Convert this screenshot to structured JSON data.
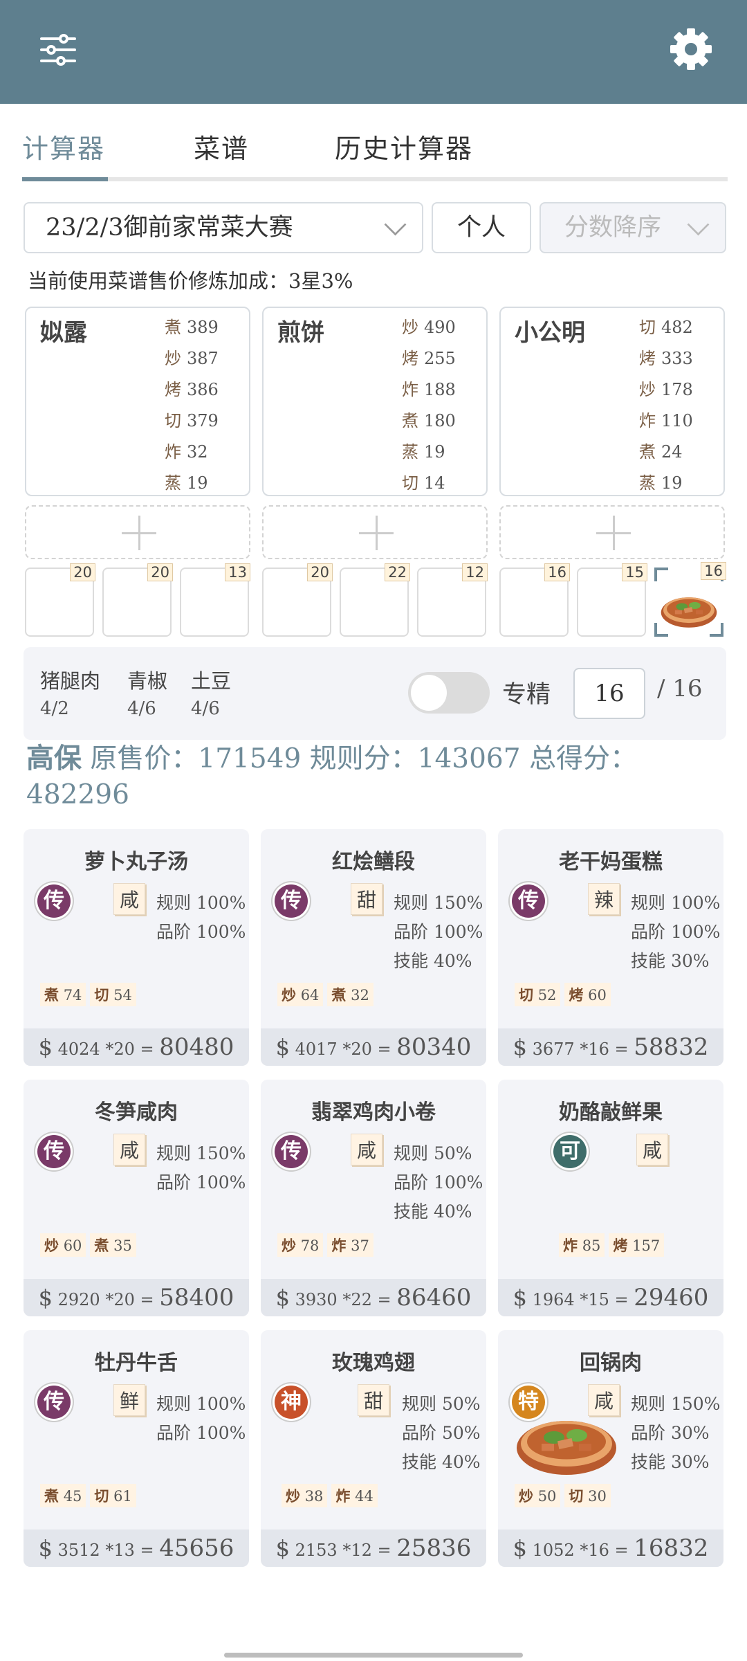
{
  "tabs": [
    "计算器",
    "菜谱",
    "历史计算器"
  ],
  "filters": {
    "contest": "23/2/3御前家常菜大赛",
    "mode": "个人",
    "sort_placeholder": "分数降序"
  },
  "info_line": "当前使用菜谱售价修炼加成：3星3%",
  "chefs": [
    {
      "name": "姒露",
      "skills": [
        {
          "k": "煮",
          "v": "389"
        },
        {
          "k": "炒",
          "v": "387"
        },
        {
          "k": "烤",
          "v": "386"
        },
        {
          "k": "切",
          "v": "379"
        },
        {
          "k": "炸",
          "v": "32"
        },
        {
          "k": "蒸",
          "v": "19"
        }
      ]
    },
    {
      "name": "煎饼",
      "skills": [
        {
          "k": "炒",
          "v": "490"
        },
        {
          "k": "烤",
          "v": "255"
        },
        {
          "k": "炸",
          "v": "188"
        },
        {
          "k": "煮",
          "v": "180"
        },
        {
          "k": "蒸",
          "v": "19"
        },
        {
          "k": "切",
          "v": "14"
        }
      ]
    },
    {
      "name": "小公明",
      "skills": [
        {
          "k": "切",
          "v": "482"
        },
        {
          "k": "烤",
          "v": "333"
        },
        {
          "k": "炒",
          "v": "178"
        },
        {
          "k": "炸",
          "v": "110"
        },
        {
          "k": "煮",
          "v": "24"
        },
        {
          "k": "蒸",
          "v": "19"
        }
      ]
    }
  ],
  "slot_counts": [
    "20",
    "20",
    "13",
    "20",
    "22",
    "12",
    "16",
    "15",
    "16"
  ],
  "ingredients": [
    {
      "name": "猪腿肉",
      "qty": "4/2"
    },
    {
      "name": "青椒",
      "qty": "4/6"
    },
    {
      "name": "土豆",
      "qty": "4/6"
    }
  ],
  "specialize": {
    "label": "专精",
    "value": "16",
    "max": "/ 16"
  },
  "summary": {
    "grade": "高保",
    "text": "原售价：171549 规则分：143067 总得分：482296"
  },
  "recipes": [
    {
      "name": "萝卜丸子汤",
      "rarity": "传",
      "rarity_color": "#7a3a68",
      "flavor": "咸",
      "stats": [
        "规则 100%",
        "品阶 100%"
      ],
      "skills": [
        {
          "k": "煮",
          "v": "74"
        },
        {
          "k": "切",
          "v": "54"
        }
      ],
      "price": "4024",
      "mult": "*20",
      "total": "80480"
    },
    {
      "name": "红烩鳝段",
      "rarity": "传",
      "rarity_color": "#7a3a68",
      "flavor": "甜",
      "stats": [
        "规则 150%",
        "品阶 100%",
        "技能 40%"
      ],
      "skills": [
        {
          "k": "炒",
          "v": "64"
        },
        {
          "k": "煮",
          "v": "32"
        }
      ],
      "price": "4017",
      "mult": "*20",
      "total": "80340"
    },
    {
      "name": "老干妈蛋糕",
      "rarity": "传",
      "rarity_color": "#7a3a68",
      "flavor": "辣",
      "stats": [
        "规则 100%",
        "品阶 100%",
        "技能 30%"
      ],
      "skills": [
        {
          "k": "切",
          "v": "52"
        },
        {
          "k": "烤",
          "v": "60"
        }
      ],
      "price": "3677",
      "mult": "*16",
      "total": "58832"
    },
    {
      "name": "冬笋咸肉",
      "rarity": "传",
      "rarity_color": "#7a3a68",
      "flavor": "咸",
      "stats": [
        "规则 150%",
        "品阶 100%"
      ],
      "skills": [
        {
          "k": "炒",
          "v": "60"
        },
        {
          "k": "煮",
          "v": "35"
        }
      ],
      "price": "2920",
      "mult": "*20",
      "total": "58400"
    },
    {
      "name": "翡翠鸡肉小卷",
      "rarity": "传",
      "rarity_color": "#7a3a68",
      "flavor": "咸",
      "stats": [
        "规则 50%",
        "品阶 100%",
        "技能 40%"
      ],
      "skills": [
        {
          "k": "炒",
          "v": "78"
        },
        {
          "k": "炸",
          "v": "37"
        }
      ],
      "price": "3930",
      "mult": "*22",
      "total": "86460"
    },
    {
      "name": "奶酪敲鲜果",
      "rarity": "可",
      "rarity_color": "#3f6d6a",
      "flavor": "咸",
      "stats": [],
      "skills": [
        {
          "k": "炸",
          "v": "85"
        },
        {
          "k": "烤",
          "v": "157"
        }
      ],
      "price": "1964",
      "mult": "*15",
      "total": "29460"
    },
    {
      "name": "牡丹牛舌",
      "rarity": "传",
      "rarity_color": "#7a3a68",
      "flavor": "鲜",
      "stats": [
        "规则 100%",
        "品阶 100%"
      ],
      "skills": [
        {
          "k": "煮",
          "v": "45"
        },
        {
          "k": "切",
          "v": "61"
        }
      ],
      "price": "3512",
      "mult": "*13",
      "total": "45656"
    },
    {
      "name": "玫瑰鸡翅",
      "rarity": "神",
      "rarity_color": "#c8512a",
      "flavor": "甜",
      "stats": [
        "规则 50%",
        "品阶 50%",
        "技能 40%"
      ],
      "skills": [
        {
          "k": "炒",
          "v": "38"
        },
        {
          "k": "炸",
          "v": "44"
        }
      ],
      "price": "2153",
      "mult": "*12",
      "total": "25836"
    },
    {
      "name": "回锅肉",
      "rarity": "特",
      "rarity_color": "#d5861e",
      "flavor": "咸",
      "stats": [
        "规则 150%",
        "品阶 30%",
        "技能 30%"
      ],
      "skills": [
        {
          "k": "炒",
          "v": "50"
        },
        {
          "k": "切",
          "v": "30"
        }
      ],
      "price": "1052",
      "mult": "*16",
      "total": "16832"
    }
  ]
}
